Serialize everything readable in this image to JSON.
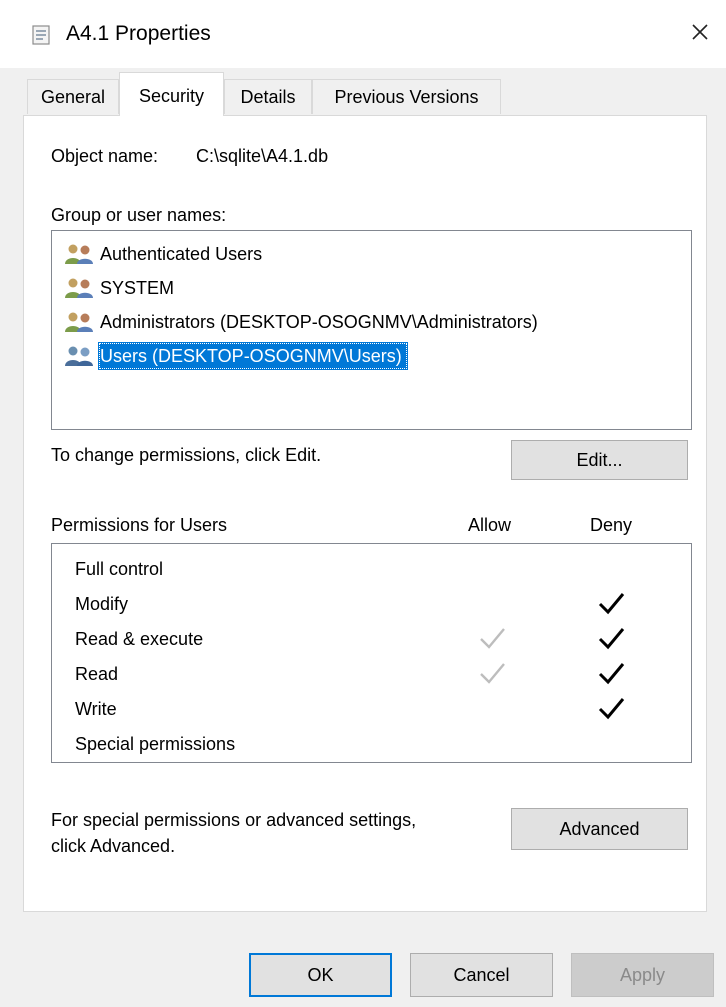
{
  "window": {
    "title": "A4.1 Properties",
    "close_glyph": "✕"
  },
  "tabs": [
    {
      "label": "General",
      "active": false
    },
    {
      "label": "Security",
      "active": true
    },
    {
      "label": "Details",
      "active": false
    },
    {
      "label": "Previous Versions",
      "active": false
    }
  ],
  "security": {
    "object_name_label": "Object name:",
    "object_name_value": "C:\\sqlite\\A4.1.db",
    "group_label": "Group or user names:",
    "groups": [
      {
        "name": "Authenticated Users",
        "icon": "users-group-icon",
        "selected": false
      },
      {
        "name": "SYSTEM",
        "icon": "users-group-icon",
        "selected": false
      },
      {
        "name": "Administrators (DESKTOP-OSOGNMV\\Administrators)",
        "icon": "users-group-icon",
        "selected": false
      },
      {
        "name": "Users (DESKTOP-OSOGNMV\\Users)",
        "icon": "users-group-icon",
        "selected": true
      }
    ],
    "change_hint": "To change permissions, click Edit.",
    "edit_button": "Edit...",
    "permissions_label": "Permissions for Users",
    "allow_header": "Allow",
    "deny_header": "Deny",
    "permissions": [
      {
        "name": "Full control",
        "allow": "none",
        "deny": "none"
      },
      {
        "name": "Modify",
        "allow": "none",
        "deny": "checked"
      },
      {
        "name": "Read & execute",
        "allow": "inherited",
        "deny": "checked"
      },
      {
        "name": "Read",
        "allow": "inherited",
        "deny": "checked"
      },
      {
        "name": "Write",
        "allow": "none",
        "deny": "checked"
      },
      {
        "name": "Special permissions",
        "allow": "none",
        "deny": "none"
      }
    ],
    "advanced_hint_line1": "For special permissions or advanced settings,",
    "advanced_hint_line2": "click Advanced.",
    "advanced_button": "Advanced"
  },
  "footer": {
    "ok": "OK",
    "cancel": "Cancel",
    "apply": "Apply"
  },
  "colors": {
    "selection": "#0078d7",
    "check_dark": "#000000",
    "check_inherited": "#bdbdbd"
  }
}
